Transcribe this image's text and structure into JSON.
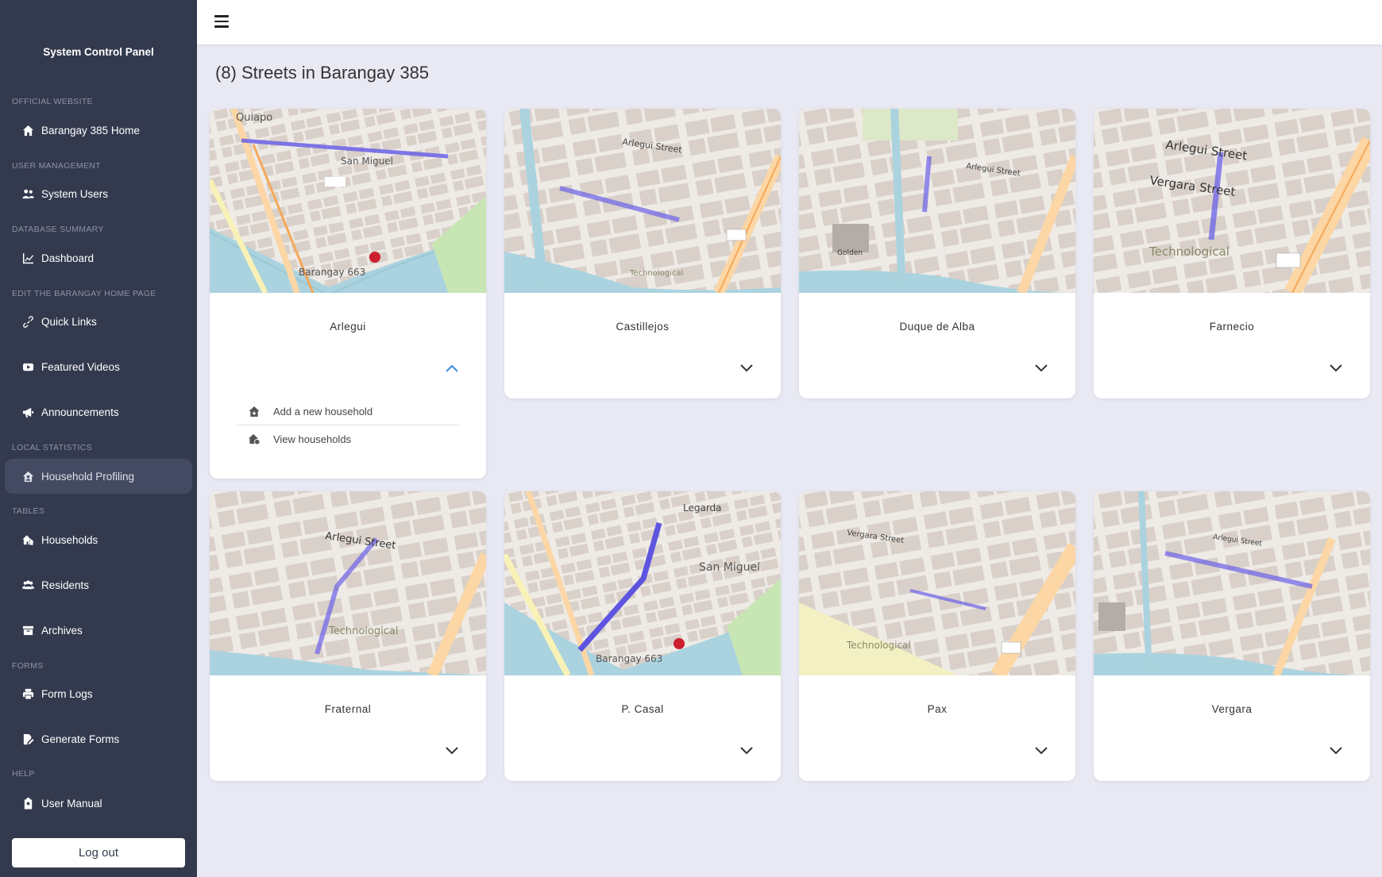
{
  "sidebar": {
    "brand": "System Control Panel",
    "sections": {
      "official": "OFFICIAL WEBSITE",
      "user_mgmt": "USER MANAGEMENT",
      "db_summary": "DATABASE SUMMARY",
      "edit_home": "EDIT THE BARANGAY HOME PAGE",
      "local_stats": "LOCAL STATISTICS",
      "tables": "TABLES",
      "forms": "FORMS",
      "help": "HELP"
    },
    "items": {
      "home": "Barangay 385 Home",
      "system_users": "System Users",
      "dashboard": "Dashboard",
      "quick_links": "Quick Links",
      "featured_videos": "Featured Videos",
      "announcements": "Announcements",
      "household_profiling": "Household Profiling",
      "households": "Households",
      "residents": "Residents",
      "archives": "Archives",
      "form_logs": "Form Logs",
      "generate_forms": "Generate Forms",
      "user_manual": "User Manual"
    },
    "logout": "Log out"
  },
  "page": {
    "title": "(8) Streets in Barangay 385"
  },
  "streets": [
    {
      "name": "Arlegui",
      "expanded": true
    },
    {
      "name": "Castillejos"
    },
    {
      "name": "Duque de Alba"
    },
    {
      "name": "Farnecio"
    },
    {
      "name": "Fraternal"
    },
    {
      "name": "P. Casal"
    },
    {
      "name": "Pax"
    },
    {
      "name": "Vergara"
    }
  ],
  "street_menu": {
    "add": "Add a new household",
    "view": "View households"
  },
  "colors": {
    "sidebar": "#343a4e",
    "route": "#6b62e8",
    "background": "#e8e9f3"
  }
}
